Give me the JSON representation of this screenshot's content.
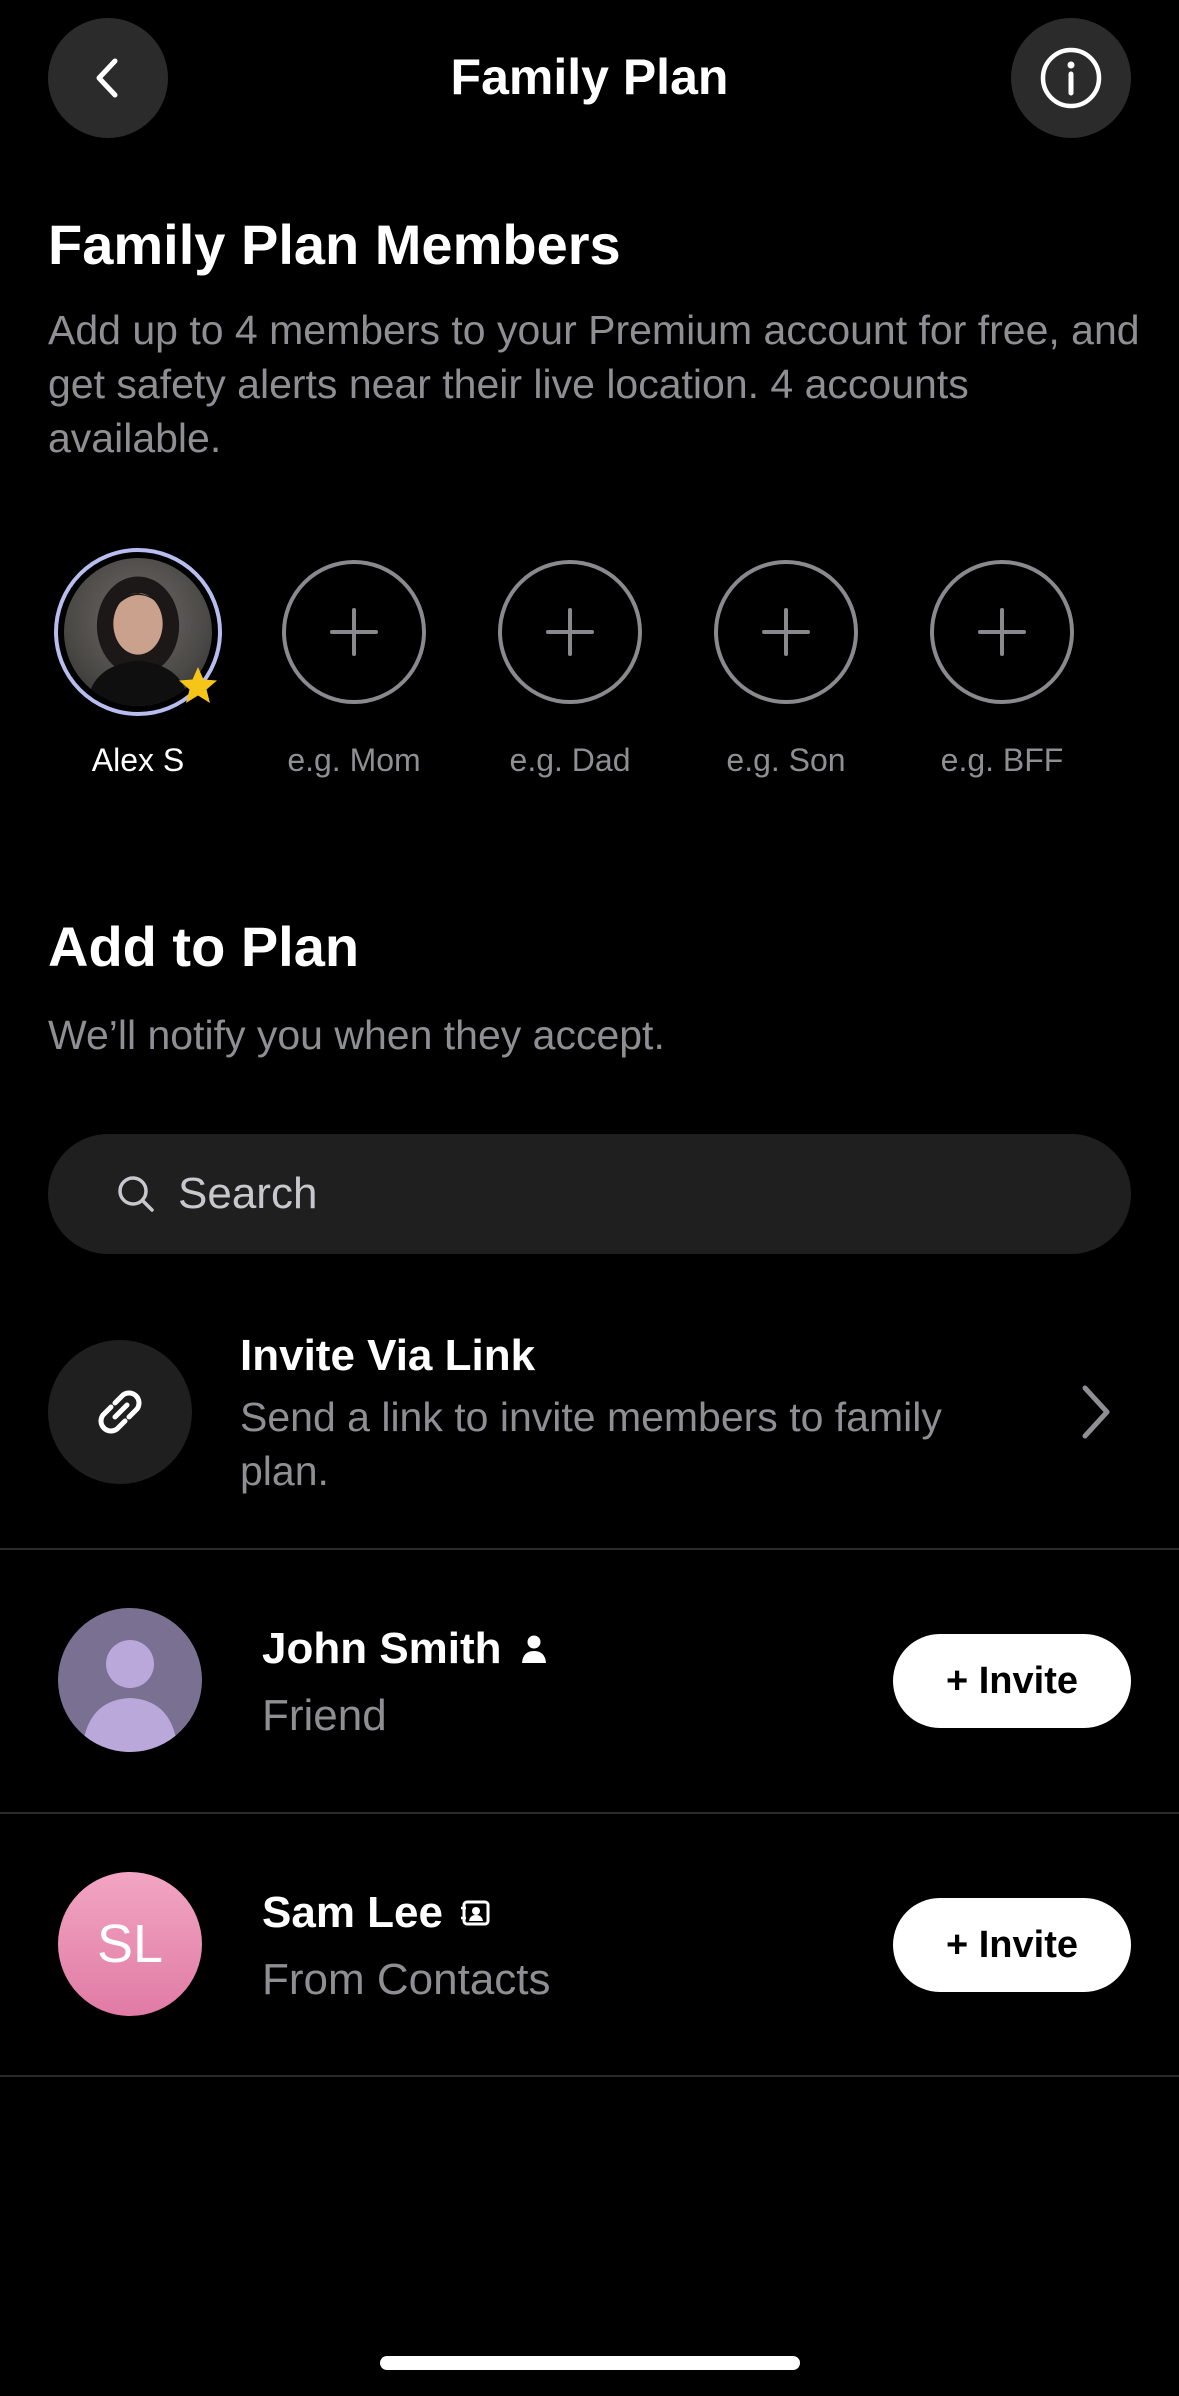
{
  "nav": {
    "title": "Family Plan",
    "back_icon": "chevron-left-icon",
    "info_icon": "info-icon"
  },
  "members_section": {
    "title": "Family Plan Members",
    "description": "Add up to 4 members to your Premium account for free, and get safety alerts near their live location. 4 accounts available.",
    "owner": {
      "name": "Alex S",
      "badge": "star-icon"
    },
    "slots": [
      {
        "placeholder": "e.g. Mom"
      },
      {
        "placeholder": "e.g. Dad"
      },
      {
        "placeholder": "e.g. Son"
      },
      {
        "placeholder": "e.g. BFF"
      }
    ]
  },
  "add_section": {
    "title": "Add to Plan",
    "subtitle": "We’ll notify you when they accept."
  },
  "search": {
    "placeholder": "Search"
  },
  "invite_link": {
    "title": "Invite Via Link",
    "description": "Send a link to invite members to family plan."
  },
  "people": [
    {
      "name": "John Smith",
      "relation": "Friend",
      "type_icon": "person-icon",
      "button": "+ Invite"
    },
    {
      "name": "Sam Lee",
      "initials": "SL",
      "relation": "From Contacts",
      "type_icon": "contact-card-icon",
      "button": "+ Invite"
    }
  ],
  "colors": {
    "background": "#000000",
    "secondary_text": "#8e8e93",
    "owner_ring": "#b8bdf0",
    "star": "#f5c518",
    "contact_avatar": "#e88fb3",
    "friend_avatar": "#8e82ad"
  }
}
